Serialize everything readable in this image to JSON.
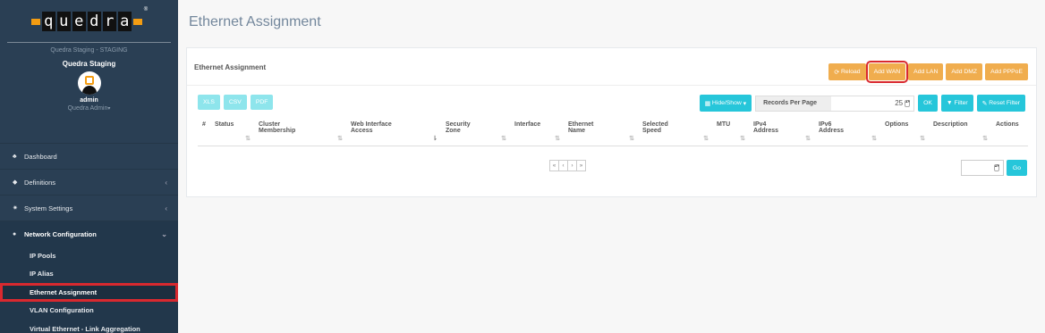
{
  "brand": {
    "logo_letters": [
      "q",
      "u",
      "e",
      "d",
      "r",
      "a"
    ],
    "logo_reg": "®",
    "subtitle": "Quedra Staging - STAGING",
    "org_name": "Quedra Staging",
    "user_name": "admin",
    "user_role": "Quedra Admin"
  },
  "sidebar": {
    "items": [
      {
        "label": "Dashboard",
        "icon": "dashboard-icon",
        "glyph": "♣"
      },
      {
        "label": "Definitions",
        "icon": "tag-icon",
        "glyph": "◆",
        "chevron": "‹"
      },
      {
        "label": "System Settings",
        "icon": "cogs-icon",
        "glyph": "✷",
        "chevron": "‹"
      },
      {
        "label": "Network Configuration",
        "icon": "globe-icon",
        "glyph": "●",
        "chevron": "⌄"
      }
    ],
    "subitems": [
      {
        "label": "IP Pools"
      },
      {
        "label": "IP Alias"
      },
      {
        "label": "Ethernet Assignment",
        "active": true
      },
      {
        "label": "VLAN Configuration"
      },
      {
        "label": "Virtual Ethernet - Link Aggregation"
      }
    ]
  },
  "page": {
    "title": "Ethernet Assignment",
    "panel_title": "Ethernet Assignment"
  },
  "header_buttons": {
    "reload": "Reload",
    "add_wan": "Add WAN",
    "add_lan": "Add LAN",
    "add_dmz": "Add DMZ",
    "add_pppoe": "Add PPPoE"
  },
  "export_buttons": {
    "xls": "XLS",
    "csv": "CSV",
    "pdf": "PDF"
  },
  "toolbar": {
    "hide_show": "Hide/Show",
    "records_per_page_label": "Records Per Page",
    "records_per_page_value": "25",
    "ok": "OK",
    "filter": "Filter",
    "reset_filter": "Reset Filter"
  },
  "table": {
    "columns": [
      {
        "line1": "#",
        "line2": ""
      },
      {
        "line1": "Status",
        "line2": ""
      },
      {
        "line1": "Cluster",
        "line2": "Membership"
      },
      {
        "line1": "Web Interface",
        "line2": "Access"
      },
      {
        "line1": "Security",
        "line2": "Zone"
      },
      {
        "line1": "Interface",
        "line2": ""
      },
      {
        "line1": "Ethernet",
        "line2": "Name"
      },
      {
        "line1": "Selected",
        "line2": "Speed"
      },
      {
        "line1": "MTU",
        "line2": ""
      },
      {
        "line1": "IPv4",
        "line2": "Address"
      },
      {
        "line1": "IPv6",
        "line2": "Address"
      },
      {
        "line1": "Options",
        "line2": ""
      },
      {
        "line1": "Description",
        "line2": ""
      },
      {
        "line1": "Actions",
        "line2": ""
      }
    ],
    "rows": []
  },
  "pagination": {
    "first": "«",
    "prev": "‹",
    "next": "›",
    "last": "»",
    "go": "Go"
  },
  "colors": {
    "sidebar_bg": "#2a3f54",
    "accent_orange": "#f0ad4e",
    "accent_teal": "#26c6da",
    "highlight_red": "#d9292f"
  }
}
